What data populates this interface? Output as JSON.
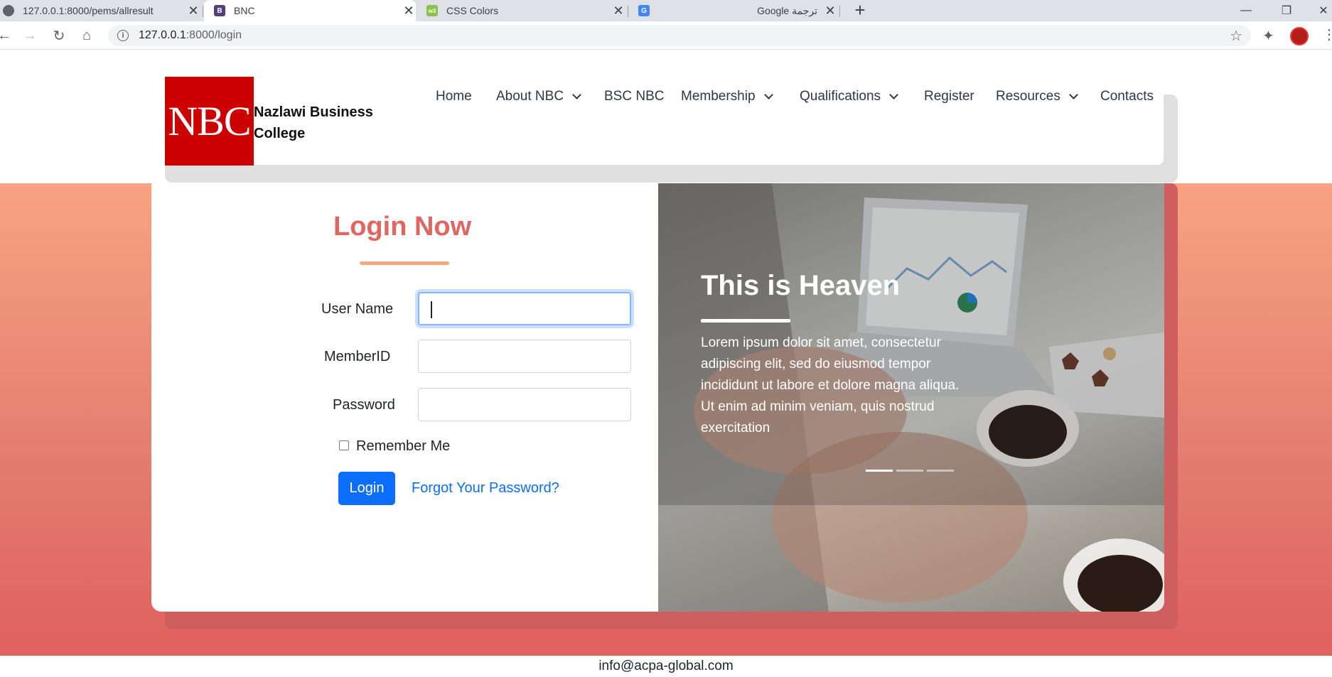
{
  "browser": {
    "tabs": [
      {
        "title": "127.0.0.1:8000/pems/allresult",
        "favicon": "globe-icon"
      },
      {
        "title": "BNC",
        "favicon": "bootstrap-icon"
      },
      {
        "title": "CSS Colors",
        "favicon": "w3schools-icon"
      },
      {
        "title": "Google ترجمة",
        "favicon": "google-translate-icon"
      }
    ],
    "new_tab": "+",
    "url_host": "127.0.0.1",
    "url_rest": ":8000/login"
  },
  "header": {
    "logo_text": "NBC",
    "brand_name": "Nazlawi Business College",
    "nav": [
      {
        "label": "Home",
        "dropdown": false
      },
      {
        "label": "About NBC",
        "dropdown": true
      },
      {
        "label": "BSC NBC",
        "dropdown": false
      },
      {
        "label": "Membership",
        "dropdown": true
      },
      {
        "label": "Qualifications",
        "dropdown": true
      },
      {
        "label": "Register",
        "dropdown": false
      },
      {
        "label": "Resources",
        "dropdown": true
      },
      {
        "label": "Contacts",
        "dropdown": false
      }
    ]
  },
  "login": {
    "title": "Login Now",
    "username_label": "User Name",
    "username_value": "",
    "memberid_label": "MemberID",
    "memberid_value": "",
    "password_label": "Password",
    "password_value": "",
    "remember_label": "Remember Me",
    "remember_checked": false,
    "button_label": "Login",
    "forgot_label": "Forgot Your Password?"
  },
  "hero": {
    "title": "This is Heaven",
    "text": "Lorem ipsum dolor sit amet, consectetur adipiscing elit, sed do eiusmod tempor incididunt ut labore et dolore magna aliqua. Ut enim ad minim veniam, quis nostrud exercitation",
    "slide_count": 3,
    "active_slide": 0
  },
  "footer": {
    "email": "info@acpa-global.com"
  },
  "colors": {
    "accent": "#df6760",
    "logo_red": "#cc0000",
    "button_blue": "#0d6efd",
    "gradient_top": "#f8a382",
    "gradient_bottom": "#e06060"
  }
}
